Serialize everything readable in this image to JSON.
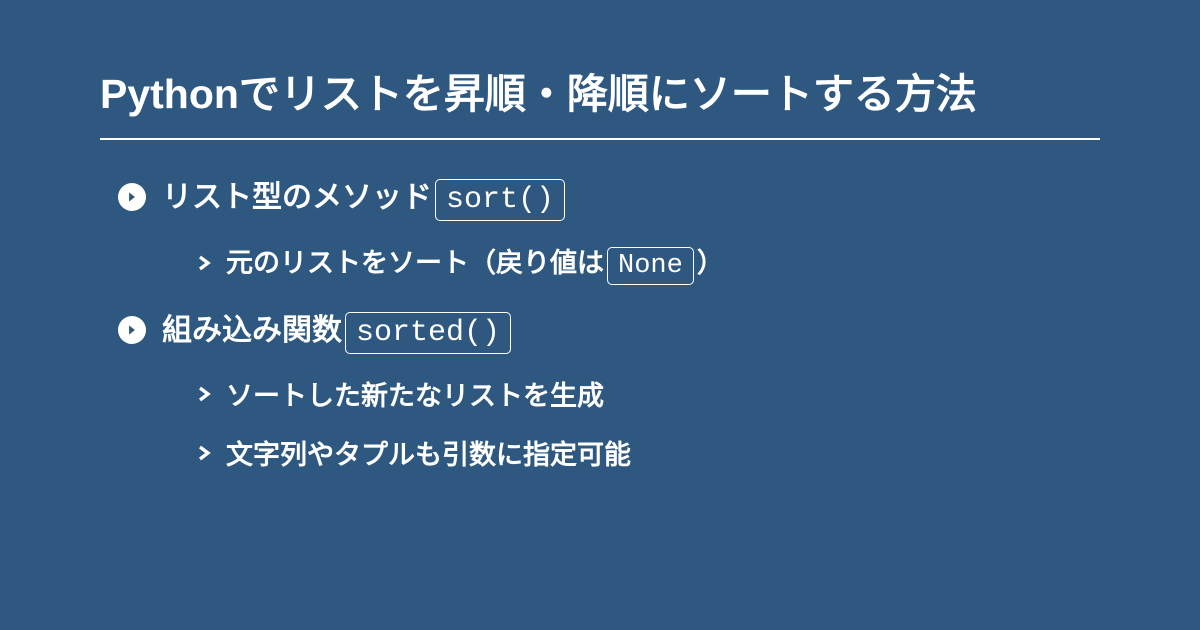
{
  "title": "Pythonでリストを昇順・降順にソートする方法",
  "colors": {
    "background": "#2e5880",
    "foreground": "#ffffff"
  },
  "items": [
    {
      "level": 1,
      "segments": [
        {
          "type": "text",
          "value": "リスト型のメソッド"
        },
        {
          "type": "code",
          "value": "sort()"
        }
      ]
    },
    {
      "level": 2,
      "segments": [
        {
          "type": "text",
          "value": "元のリストをソート（戻り値は"
        },
        {
          "type": "code",
          "value": "None"
        },
        {
          "type": "text",
          "value": "）"
        }
      ]
    },
    {
      "level": 1,
      "segments": [
        {
          "type": "text",
          "value": "組み込み関数"
        },
        {
          "type": "code",
          "value": "sorted()"
        }
      ]
    },
    {
      "level": 2,
      "segments": [
        {
          "type": "text",
          "value": "ソートした新たなリストを生成"
        }
      ]
    },
    {
      "level": 2,
      "segments": [
        {
          "type": "text",
          "value": "文字列やタプルも引数に指定可能"
        }
      ]
    }
  ]
}
